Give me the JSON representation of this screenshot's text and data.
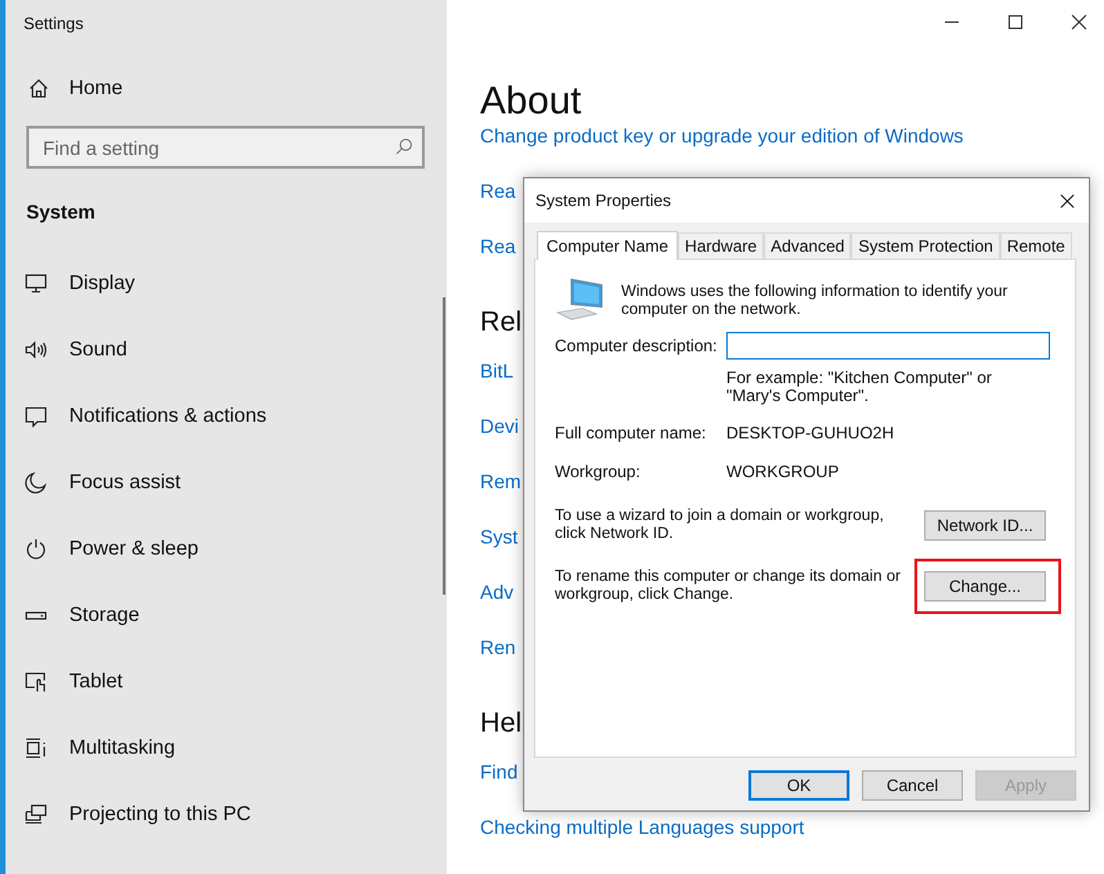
{
  "window": {
    "title": "Settings"
  },
  "sidebar": {
    "home": "Home",
    "search": {
      "placeholder": "Find a setting"
    },
    "section": "System",
    "items": [
      {
        "label": "Display",
        "kind": "display"
      },
      {
        "label": "Sound",
        "kind": "sound"
      },
      {
        "label": "Notifications & actions",
        "kind": "notifications"
      },
      {
        "label": "Focus assist",
        "kind": "moon"
      },
      {
        "label": "Power & sleep",
        "kind": "power"
      },
      {
        "label": "Storage",
        "kind": "storage"
      },
      {
        "label": "Tablet",
        "kind": "tablet"
      },
      {
        "label": "Multitasking",
        "kind": "multitasking"
      },
      {
        "label": "Projecting to this PC",
        "kind": "projecting"
      }
    ]
  },
  "page": {
    "title": "About",
    "items": [
      {
        "text": "Change product key or upgrade your edition of Windows",
        "kind": "link"
      },
      {
        "text": "Rea",
        "kind": "link"
      },
      {
        "text": "Rea",
        "kind": "link"
      },
      {
        "text": "Rel",
        "kind": "heading"
      },
      {
        "text": "BitL",
        "kind": "link"
      },
      {
        "text": "Devi",
        "kind": "link"
      },
      {
        "text": "Rem",
        "kind": "link"
      },
      {
        "text": "Syst",
        "kind": "link"
      },
      {
        "text": "Adv",
        "kind": "link"
      },
      {
        "text": "Ren",
        "kind": "link"
      },
      {
        "text": "Hel",
        "kind": "heading"
      },
      {
        "text": "Find",
        "kind": "link"
      },
      {
        "text": "Checking multiple Languages support",
        "kind": "link"
      }
    ]
  },
  "dialog": {
    "title": "System Properties",
    "tabs": [
      {
        "label": "Computer Name",
        "selected": true
      },
      {
        "label": "Hardware",
        "selected": false
      },
      {
        "label": "Advanced",
        "selected": false
      },
      {
        "label": "System Protection",
        "selected": false
      },
      {
        "label": "Remote",
        "selected": false
      }
    ],
    "intro": "Windows uses the following information to identify your computer on the network.",
    "description": {
      "label": "Computer description:",
      "hint": "For example: \"Kitchen Computer\" or \"Mary's Computer\"."
    },
    "fields": [
      {
        "label": "Full computer name:",
        "value": "DESKTOP-GUHUO2H"
      },
      {
        "label": "Workgroup:",
        "value": "WORKGROUP"
      }
    ],
    "actions": [
      {
        "text": "To use a wizard to join a domain or workgroup, click Network ID.",
        "button": "Network ID...",
        "highlighted": false
      },
      {
        "text": "To rename this computer or change its domain or workgroup, click Change.",
        "button": "Change...",
        "highlighted": true
      }
    ],
    "buttons": [
      {
        "label": "OK",
        "default": true,
        "disabled": false
      },
      {
        "label": "Cancel",
        "default": false,
        "disabled": false
      },
      {
        "label": "Apply",
        "default": false,
        "disabled": true
      }
    ]
  }
}
